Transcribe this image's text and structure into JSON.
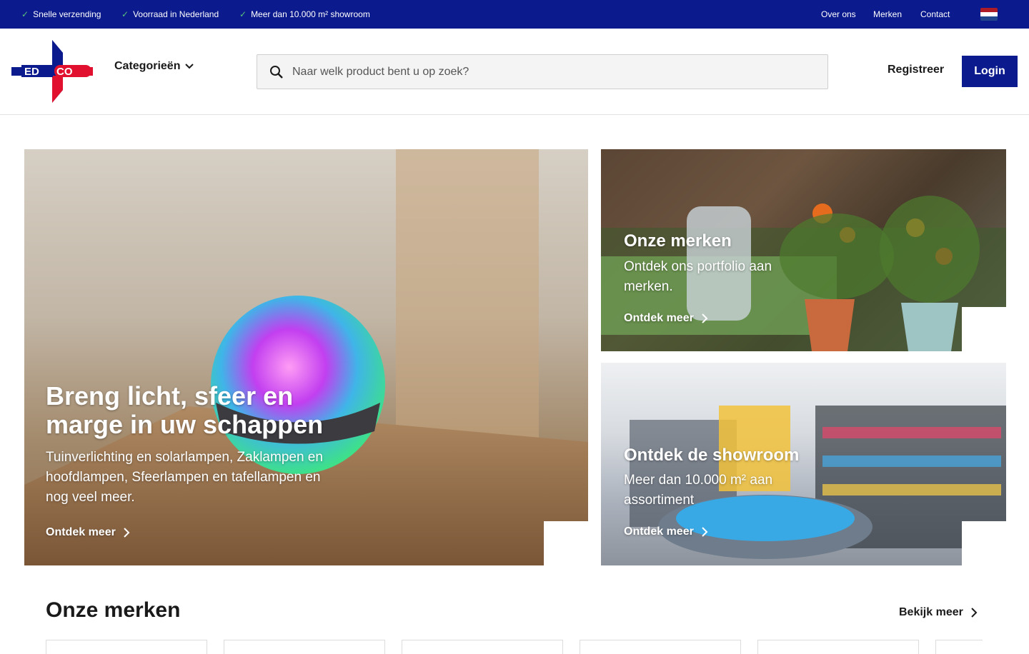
{
  "topbar": {
    "usps": [
      "Snelle verzending",
      "Voorraad in Nederland",
      "Meer dan 10.000 m² showroom"
    ],
    "links": [
      "Over ons",
      "Merken",
      "Contact"
    ],
    "language_flag": "flag-nl-icon",
    "colors": {
      "background": "#0b1a8c",
      "check": "#5ac27a"
    }
  },
  "header": {
    "logo_text": "EDCO",
    "categories_label": "Categorieën",
    "search_placeholder": "Naar welk product bent u op zoek?",
    "register_label": "Registreer",
    "login_label": "Login",
    "colors": {
      "brand_blue": "#0b1a8c",
      "brand_red": "#e0102e"
    }
  },
  "tiles": {
    "main": {
      "title": "Breng licht, sfeer en marge in uw schappen",
      "description": "Tuinverlichting en solarlampen, Zaklampen en hoofdlampen, Sfeerlampen en tafellampen en nog veel meer.",
      "link_label": "Ontdek meer"
    },
    "brands": {
      "title": "Onze merken",
      "description": "Ontdek ons portfolio aan merken.",
      "link_label": "Ontdek meer"
    },
    "showroom": {
      "title": "Ontdek de showroom",
      "description": "Meer dan 10.000 m² aan assortiment",
      "link_label": "Ontdek meer"
    }
  },
  "brands_section": {
    "heading": "Onze merken",
    "more_label": "Bekijk meer"
  }
}
